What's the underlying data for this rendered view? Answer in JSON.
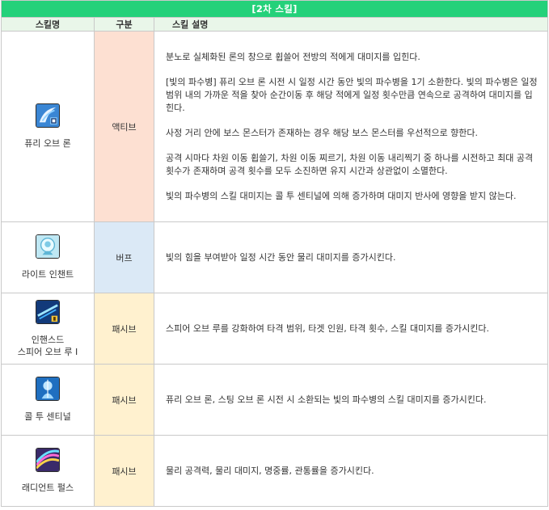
{
  "title": "[2차 스킬]",
  "headers": {
    "name": "스킬명",
    "type": "구분",
    "desc": "스킬 설명"
  },
  "rows": [
    {
      "name_lines": [
        "퓨리 오브 론"
      ],
      "icon": "fury-of-ron-icon",
      "type": "액티브",
      "desc": [
        "분노로 실체화된 론의 창으로 휩쓸어 전방의 적에게 대미지를 입힌다.",
        "[빛의 파수병] 퓨리 오브 론 시전 시 일정 시간 동안 빛의 파수병을 1기 소환한다. 빛의 파수병은 일정 범위 내의 가까운 적을 찾아 순간이동 후 해당 적에게 일정 횟수만큼 연속으로 공격하여 대미지를 입힌다.",
        "사정 거리 안에 보스 몬스터가 존재하는 경우 해당 보스 몬스터를 우선적으로 향한다.",
        "공격 시마다 차원 이동 휩쓸기, 차원 이동 찌르기, 차원 이동 내리찍기 중 하나를 시전하고 최대 공격 횟수가 존재하며 공격 횟수를 모두 소진하면 유지 시간과 상관없이 소멸한다.",
        "빛의 파수병의 스킬 대미지는 콜 투 센티널에 의해 증가하며 대미지 반사에 영향을 받지 않는다."
      ]
    },
    {
      "name_lines": [
        "라이트 인챈트"
      ],
      "icon": "light-enchant-icon",
      "type": "버프",
      "desc": [
        "빛의 힘을 부여받아 일정 시간 동안 물리 대미지를 증가시킨다."
      ]
    },
    {
      "name_lines": [
        "인핸스드",
        "스피어 오브 루 I"
      ],
      "icon": "enhanced-spear-of-ru-icon",
      "type": "패시브",
      "desc": [
        "스피어 오브 루를 강화하여 타격 범위, 타겟 인원, 타격 횟수, 스킬 대미지를 증가시킨다."
      ]
    },
    {
      "name_lines": [
        "콜 투 센티널"
      ],
      "icon": "call-to-sentinel-icon",
      "type": "패시브",
      "desc": [
        "퓨리 오브 론, 스팅 오브 론 시전 시 소환되는 빛의 파수병의 스킬 대미지를 증가시킨다."
      ]
    },
    {
      "name_lines": [
        "래디언트 펄스"
      ],
      "icon": "radiant-pulse-icon",
      "type": "패시브",
      "desc": [
        "물리 공격력, 물리 대미지, 명중률, 관통률을 증가시킨다."
      ]
    }
  ]
}
